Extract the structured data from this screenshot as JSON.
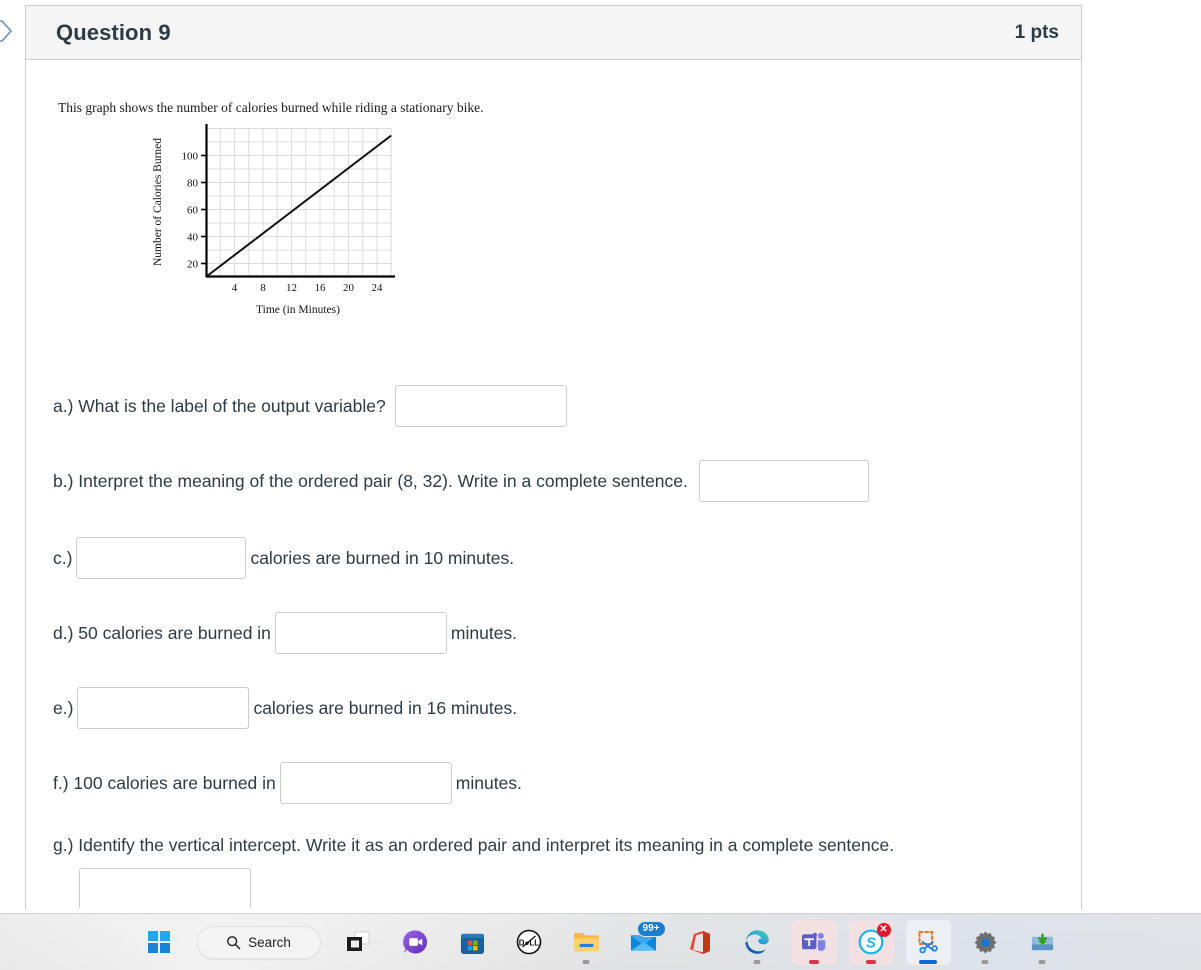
{
  "header": {
    "title": "Question 9",
    "points": "1 pts"
  },
  "prompt": "This graph shows the number of calories burned while riding a stationary bike.",
  "chart_data": {
    "type": "line",
    "title": "",
    "xlabel": "Time (in Minutes)",
    "ylabel": "Number of Calories Burned",
    "xlim": [
      0,
      26
    ],
    "ylim": [
      0,
      110
    ],
    "xticks": [
      4,
      8,
      12,
      16,
      20,
      24
    ],
    "yticks": [
      20,
      40,
      60,
      80,
      100
    ],
    "xtick_labels": [
      "4",
      "8",
      "12",
      "16",
      "20",
      "24"
    ],
    "ytick_labels": [
      "20",
      "40",
      "60",
      "80",
      "100"
    ],
    "grid": true,
    "grid_x_minor_step": 2,
    "grid_y_minor_step": 10,
    "legend": "none",
    "series": [
      {
        "name": "Calories burned",
        "x": [
          0,
          26
        ],
        "values": [
          0,
          104
        ],
        "slope": 4,
        "intercept": 0
      }
    ]
  },
  "questions": {
    "a": {
      "text": "a.) What is the label of the output variable?",
      "answer": "",
      "placeholder": ""
    },
    "b": {
      "text": "b.) Interpret the meaning of the ordered pair (8, 32). Write in a complete sentence.",
      "answer": "",
      "placeholder": ""
    },
    "c": {
      "prefix": "c.)",
      "suffix": "calories are burned in 10 minutes.",
      "answer": "",
      "placeholder": ""
    },
    "d": {
      "prefix": "d.) 50 calories are burned in",
      "suffix": "minutes.",
      "answer": "",
      "placeholder": ""
    },
    "e": {
      "prefix": "e.)",
      "suffix": "calories are burned in 16 minutes.",
      "answer": "",
      "placeholder": ""
    },
    "f": {
      "prefix": "f.) 100 calories are burned in",
      "suffix": "minutes.",
      "answer": "",
      "placeholder": ""
    },
    "g": {
      "text": "g.) Identify the vertical intercept. Write it as an ordered pair and interpret its meaning in a complete sentence.",
      "answer": "",
      "placeholder": ""
    }
  },
  "taskbar": {
    "search_label": "Search",
    "mail_badge": "99+",
    "items": [
      {
        "name": "start-button",
        "label": "Start"
      },
      {
        "name": "search-box",
        "label": "Search"
      },
      {
        "name": "task-view-button",
        "label": "Task View"
      },
      {
        "name": "chat-button",
        "label": "Chat"
      },
      {
        "name": "microsoft-store-button",
        "label": "Microsoft Store"
      },
      {
        "name": "dell-button",
        "label": "Dell"
      },
      {
        "name": "file-explorer-button",
        "label": "File Explorer"
      },
      {
        "name": "mail-button",
        "label": "Mail"
      },
      {
        "name": "office-button",
        "label": "Office"
      },
      {
        "name": "edge-button",
        "label": "Microsoft Edge"
      },
      {
        "name": "teams-button",
        "label": "Microsoft Teams"
      },
      {
        "name": "skype-button",
        "label": "Skype"
      },
      {
        "name": "snipping-tool-button",
        "label": "Snipping Tool"
      },
      {
        "name": "settings-button",
        "label": "Settings"
      },
      {
        "name": "installer-button",
        "label": "Installer"
      }
    ]
  },
  "colors": {
    "text": "#2d3b45",
    "border": "#c7cdd1",
    "header_bg": "#f5f5f5",
    "taskbar_bg": "#e4e4e4",
    "accent_blue": "#0a69d6"
  }
}
